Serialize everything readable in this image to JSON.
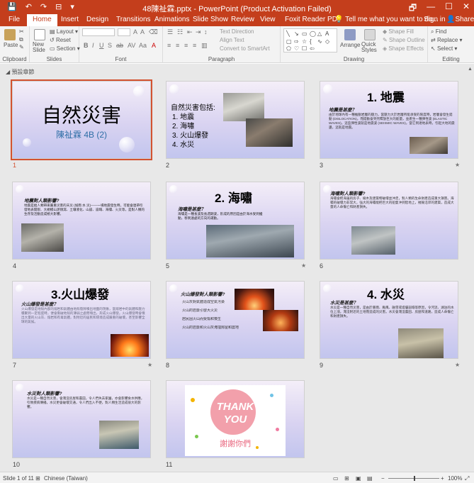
{
  "titlebar": {
    "doc_title": "48陳祉霖.pptx - PowerPoint (Product Activation Failed)",
    "qat": [
      "💾",
      "↶",
      "↷",
      "⊟",
      "▾"
    ],
    "controls": [
      "🗗",
      "—",
      "☐",
      "✕"
    ]
  },
  "tabs": [
    {
      "label": "File",
      "active": false
    },
    {
      "label": "Home",
      "active": true
    },
    {
      "label": "Insert",
      "active": false
    },
    {
      "label": "Design",
      "active": false
    },
    {
      "label": "Transitions",
      "active": false
    },
    {
      "label": "Animations",
      "active": false
    },
    {
      "label": "Slide Show",
      "active": false
    },
    {
      "label": "Review",
      "active": false
    },
    {
      "label": "View",
      "active": false
    },
    {
      "label": "Foxit Reader PDF",
      "active": false
    }
  ],
  "tell_me": "Tell me what you want to do...",
  "sign_in": "Sign in",
  "share": "Share",
  "ribbon": {
    "paste": "Paste",
    "new_slide": "New Slide",
    "layout": "Layout",
    "reset": "Reset",
    "section": "Section",
    "text_direction": "Text Direction",
    "align_text": "Align Text",
    "convert_smartart": "Convert to SmartArt",
    "arrange": "Arrange",
    "quick_styles": "Quick Styles",
    "shape_fill": "Shape Fill",
    "shape_outline": "Shape Outline",
    "shape_effects": "Shape Effects",
    "find": "Find",
    "replace": "Replace",
    "select": "Select",
    "groups": [
      "Clipboard",
      "Slides",
      "Font",
      "Paragraph",
      "Drawing",
      "Editing"
    ]
  },
  "section_header": "◢ 預設章節",
  "slides": [
    {
      "num": "1",
      "title": "自然災害",
      "subtitle": "陳祉霖 4B (2)"
    },
    {
      "num": "2",
      "title": "自然災害包括:",
      "items": [
        "1. 地震",
        "2. 海嘯",
        "3. 火山爆發",
        "4. 水災"
      ]
    },
    {
      "num": "3",
      "title": "1. 地震",
      "sub": "地震是甚麼？",
      "body": "由於地球內有一種推動岩層的壓力，當壓力大於岩層所能承受的限度時，岩層會發生錯動 (DISLOCATION)，而錯動會突然釋放巨大的能量，並產生一種彈性波 (ELASTIC WAVES)，這些彈性波就是地震波 (SEISMIC WAVES)，當它到達地表時，引起大地的震盪，這就是地震。"
    },
    {
      "num": "4",
      "sub": "地震對人類影響?",
      "body": "地震是給人類帶來嚴重災害的天災 (如雨 水 災)——一場地震發生時，可能會連帶引發地表開裂、大規模山泥傾瀉、土壤液化、山崩、崩塌、海嘯、火災等，是對人類的生存及活動造成極大影響。"
    },
    {
      "num": "5",
      "title": "2. 海嘯",
      "sub": "海嘯是甚麼？",
      "body": "海嘯是一種長波及長週期波，形成的原因是由於海水受到擾動，移到遠處的方向的運動。"
    },
    {
      "num": "6",
      "sub": "海嘯對人類影響?",
      "body": "海嘯會把海邊的房子、樹木及建築物破壞並沖走，對人類的生命財產造成重大損害。海嘯的破壞力非常大，強大的海嘯能把巨大的船隻沖到陸地上，摧毀沿岸的建築，造成大量的人命傷亡和財產損失。"
    },
    {
      "num": "7",
      "title": "3.火山爆發",
      "sub": "火山爆發是甚麼？",
      "body": "火山爆發是地殼內部的熔岩和氣體由地殼裂隙噴出地面的現象，當熔岩中的氣體和壓力積聚到一定程度時，便會衝破地殼的薄弱之處而噴出，形成火山爆發。火山爆發時會噴出大量的火山灰、熔岩和有毒氣體，對附近的居民和環境造成嚴重的破壞，甚至影響全球的氣候。"
    },
    {
      "num": "8",
      "sub": "火山爆發對人類影響?",
      "items": [
        "火山灰對氣體造成空氣污染",
        "火山的岩漿引發大火災",
        "居民因火山而受傷和喪生",
        "火山的岩漿和火山灰淹埋房屋和農地"
      ]
    },
    {
      "num": "9",
      "title": "4. 水災",
      "sub": "水災是甚麼？",
      "body": "水災是一種自然災害，是由於暴雨、颱風、融雪或堤壩崩塌等原因，令河流、湖泊的水位上漲，淹沒附近的土地而造成的災害。水災會淹沒農田、房屋和道路，造成人命傷亡和財產損失。"
    },
    {
      "num": "10",
      "sub": "水災對人類影響?",
      "body": "水災是一種自然災害，會淹沒房屋和農田，令人們失去家園，亦會影響食水供應，引致疾病傳播。水災更會破壞交通，令人們出入不便，對人類生活造成很大的影響。"
    },
    {
      "num": "11",
      "thanks1": "THANK",
      "thanks2": "YOU",
      "thanks_cn": "謝謝你們"
    }
  ],
  "status": {
    "slide_of": "Slide 1 of 11",
    "language": "Chinese (Taiwan)",
    "zoom": "100%"
  }
}
